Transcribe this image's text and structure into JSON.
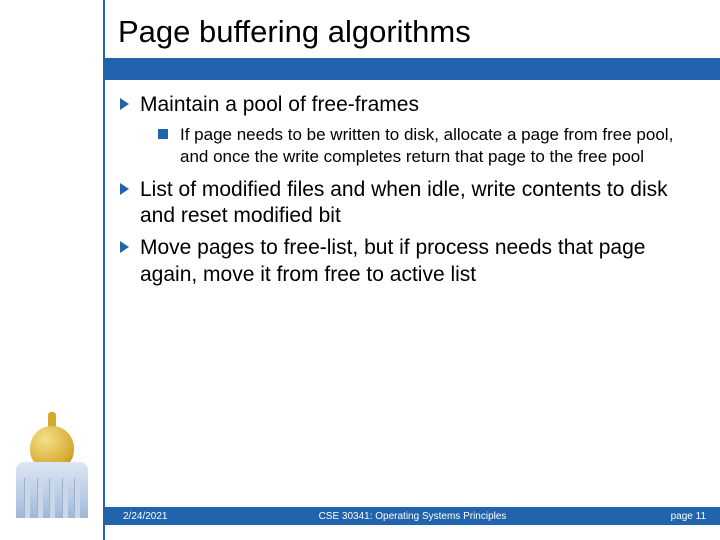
{
  "title": "Page buffering algorithms",
  "bullets": [
    {
      "text": "Maintain a pool of free-frames",
      "sub": [
        "If page needs to be written to disk, allocate a page from free pool, and once the write completes return that page to the free pool"
      ]
    },
    {
      "text": "List of modified files and when idle, write contents to disk and reset modified bit",
      "sub": []
    },
    {
      "text": "Move pages to free-list, but if process needs that page again, move it from free to active list",
      "sub": []
    }
  ],
  "footer": {
    "date": "2/24/2021",
    "course": "CSE 30341: Operating Systems Principles",
    "page": "page 11"
  }
}
